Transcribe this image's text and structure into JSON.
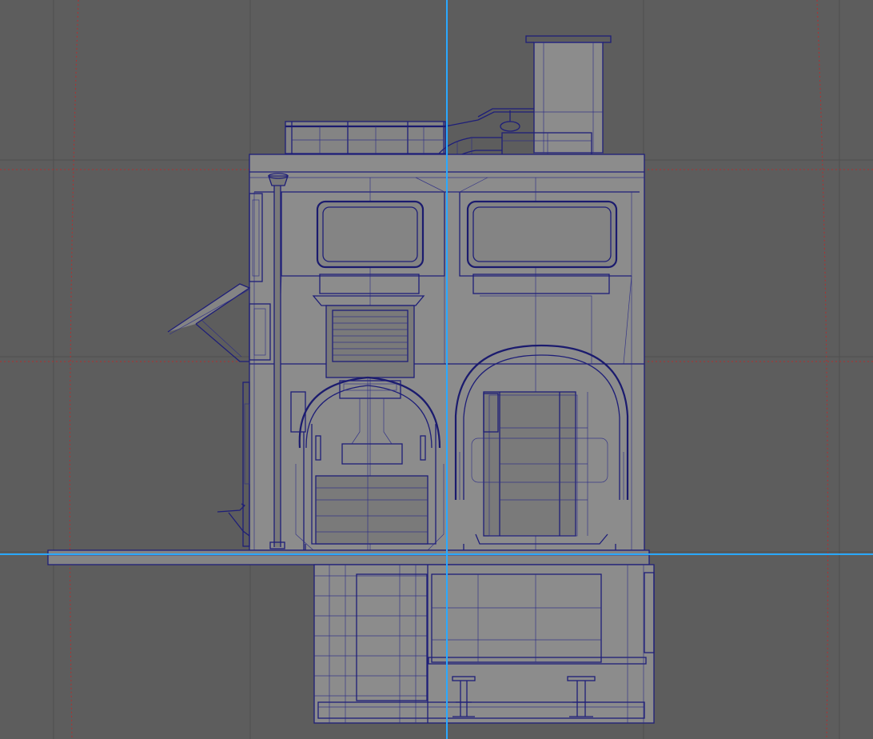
{
  "viewport": {
    "view": "orthographic-front",
    "display_mode": "wireframe-on-shaded",
    "background_color": "#5d5d5d",
    "grid_color": "#4e4e4e",
    "camera_gate_color": "#b03030",
    "reference_line_color": "#2aa8ff",
    "wire_color": "#1e1e78",
    "model_shade_color": "#8a8a8a",
    "grid_visible": true,
    "camera_gate_visible": true
  },
  "model": {
    "name": "",
    "parts": [
      "rooftop-railing",
      "chimney-vent",
      "upper-windows",
      "vent-grille",
      "entrance-door",
      "arched-doorway",
      "awning",
      "drainpipe",
      "wall-lamp",
      "basement-level",
      "bar-stools"
    ]
  }
}
